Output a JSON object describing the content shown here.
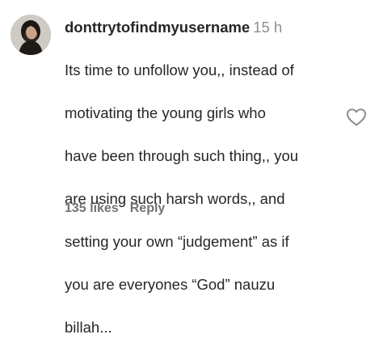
{
  "comment": {
    "username": "donttrytofindmyusername",
    "time": "15 h",
    "text_lines": [
      "Its time to unfollow you,, instead of",
      "motivating the young girls who",
      "have been through such thing,, you",
      "are using such harsh words,, and",
      "setting your own “judgement” as if",
      "you are everyones “God” nauzu",
      "billah..."
    ],
    "likes": "135 likes",
    "reply_label": "Reply"
  },
  "icons": {
    "like": "heart-outline-icon",
    "avatar": "profile-avatar"
  },
  "colors": {
    "text": "#262626",
    "muted": "#8e8e8e",
    "action": "#737373"
  }
}
